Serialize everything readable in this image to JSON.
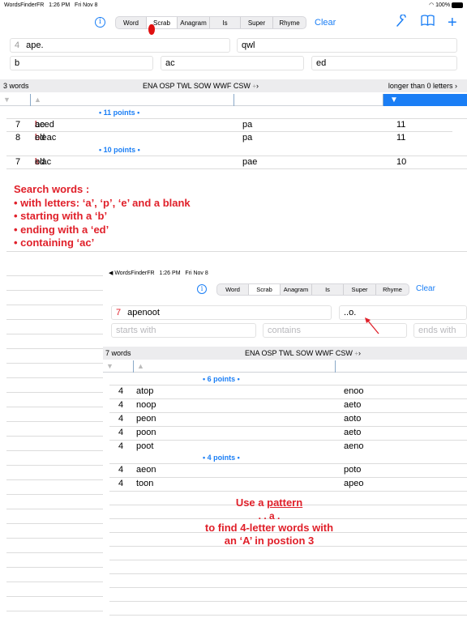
{
  "status": {
    "app": "WordsFinderFR",
    "time": "1:26 PM",
    "date": "Fri Nov 8",
    "battery": "100%"
  },
  "toolbar": {
    "modes": [
      "Word",
      "Scrab",
      "Anagram",
      "Is",
      "Super",
      "Rhyme"
    ],
    "selected_mode": "Scrab",
    "clear_label": "Clear"
  },
  "inputs": {
    "letters_count": "4",
    "letters": "ape.",
    "pattern": "qwl",
    "starts_with": "b",
    "contains": "ac",
    "ends_with": "ed"
  },
  "results_header": {
    "count": "3 words",
    "dictionaries": "ENA OSP TWL SOW WWF CSW",
    "length_filter": "longer than 0 letters"
  },
  "groups": [
    {
      "points": "• 11 points •",
      "rows": [
        {
          "n": "7",
          "word": "belaced",
          "pre": "be",
          "blank": "l",
          "post": "aced",
          "pattern": "pa",
          "score": "11"
        },
        {
          "n": "8",
          "word": "bleached",
          "pre": "bleac",
          "blank": "h",
          "post": "ed",
          "pattern": "pa",
          "score": "11"
        }
      ]
    },
    {
      "points": "• 10 points •",
      "rows": [
        {
          "n": "7",
          "word": "blacked",
          "pre": "blac",
          "blank": "k",
          "post": "ed",
          "pattern": "pae",
          "score": "10"
        }
      ]
    }
  ],
  "annotation1": [
    "Search words :",
    "• with letters: ‘a’, ‘p’, ‘e’ and a blank",
    "• starting with a ‘b’",
    "• ending with a ‘ed’",
    "• containing ‘ac’"
  ],
  "inset": {
    "status": {
      "app": "◀ WordsFinderFR",
      "time": "1:26 PM",
      "date": "Fri Nov 8"
    },
    "clear_label": "Clear",
    "letters_count": "7",
    "letters": "apenoot",
    "pattern": "..o.",
    "starts_placeholder": "starts with",
    "contains_placeholder": "contains",
    "ends_placeholder": "ends with",
    "count": "7 words",
    "dictionaries": "ENA OSP TWL SOW WWF CSW",
    "groups": [
      {
        "points": "• 6 points •",
        "rows": [
          {
            "n": "4",
            "word": "atop",
            "rest": "enoo"
          },
          {
            "n": "4",
            "word": "noop",
            "rest": "aeto"
          },
          {
            "n": "4",
            "word": "peon",
            "rest": "aoto"
          },
          {
            "n": "4",
            "word": "poon",
            "rest": "aeto"
          },
          {
            "n": "4",
            "word": "poot",
            "rest": "aeno"
          }
        ]
      },
      {
        "points": "• 4 points •",
        "rows": [
          {
            "n": "4",
            "word": "aeon",
            "rest": "poto"
          },
          {
            "n": "4",
            "word": "toon",
            "rest": "apeo"
          }
        ]
      }
    ]
  },
  "annotation2": {
    "prefix": "Use a ",
    "pattern_word": "pattern",
    "example": ". . a .",
    "line1": "to find 4-letter words with",
    "line2": "an ‘A’ in postion 3"
  },
  "colors": {
    "accent": "#1a7ef5",
    "annotation": "#e0202a",
    "blank_letter": "#e0202a"
  },
  "icons": [
    "info-icon",
    "wrench-icon",
    "book-icon",
    "plus-icon",
    "wifi-icon",
    "battery-icon",
    "chevron-right-icon",
    "triangle-up-icon",
    "triangle-down-icon",
    "arrow-icon"
  ]
}
